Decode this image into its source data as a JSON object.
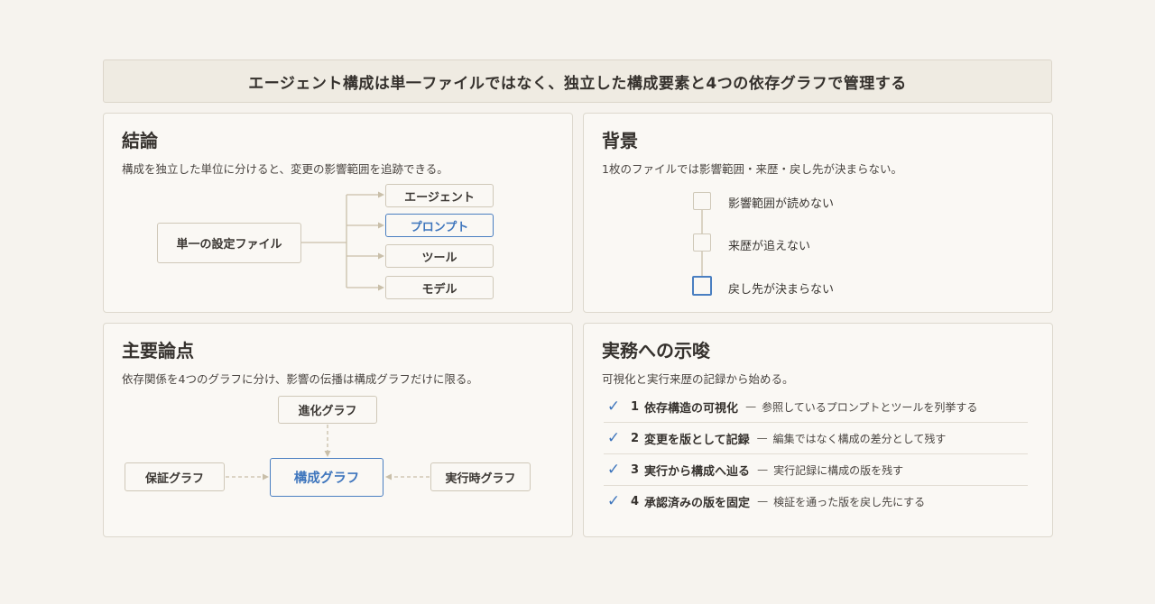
{
  "title": "エージェント構成は単一ファイルではなく、独立した構成要素と4つの依存グラフで管理する",
  "conclusion": {
    "heading": "結論",
    "subtitle": "構成を独立した単位に分けると、変更の影響範囲を追跡できる。",
    "source": "単一の設定ファイル",
    "targets": [
      "エージェント",
      "プロンプト",
      "ツール",
      "モデル"
    ]
  },
  "background": {
    "heading": "背景",
    "subtitle": "1枚のファイルでは影響範囲・来歴・戻し先が決まらない。",
    "steps": [
      "影響範囲が読めない",
      "来歴が追えない",
      "戻し先が決まらない"
    ]
  },
  "points": {
    "heading": "主要論点",
    "subtitle": "依存関係を4つのグラフに分け、影響の伝播は構成グラフだけに限る。",
    "top": "進化グラフ",
    "left": "保証グラフ",
    "center": "構成グラフ",
    "right": "実行時グラフ"
  },
  "implications": {
    "heading": "実務への示唆",
    "subtitle": "可視化と実行来歴の記録から始める。",
    "items": [
      {
        "num": "1",
        "main": "依存構造の可視化",
        "dash": "—",
        "desc": "参照しているプロンプトとツールを列挙する"
      },
      {
        "num": "2",
        "main": "変更を版として記録",
        "dash": "—",
        "desc": "編集ではなく構成の差分として残す"
      },
      {
        "num": "3",
        "main": "実行から構成へ辿る",
        "dash": "—",
        "desc": "実行記録に構成の版を残す"
      },
      {
        "num": "4",
        "main": "承認済みの版を固定",
        "dash": "—",
        "desc": "検証を通った版を戻し先にする"
      }
    ]
  },
  "colors": {
    "accent": "#4a7fc1",
    "border": "#cfc8b8",
    "background": "#f6f3ee"
  },
  "icons": {
    "check": "check-icon"
  }
}
